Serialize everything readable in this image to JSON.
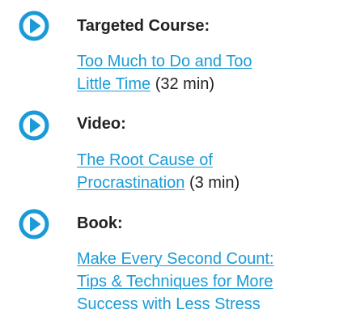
{
  "colors": {
    "accent": "#1a9bd7",
    "text": "#222222"
  },
  "items": [
    {
      "icon": "play-circle-icon",
      "heading": "Targeted Course:",
      "link_line1": "Too Much to Do and Too",
      "link_line2": "Little Time",
      "duration": "(32 min)"
    },
    {
      "icon": "play-circle-icon",
      "heading": "Video:",
      "link_line1": "The Root Cause of",
      "link_line2": "Procrastination",
      "duration": "(3 min)"
    },
    {
      "icon": "play-circle-icon",
      "heading": "Book:",
      "link_line1": "Make Every Second Count:",
      "link_line2": "Tips & Techniques for More",
      "link_line3": "Success with Less Stress"
    }
  ]
}
